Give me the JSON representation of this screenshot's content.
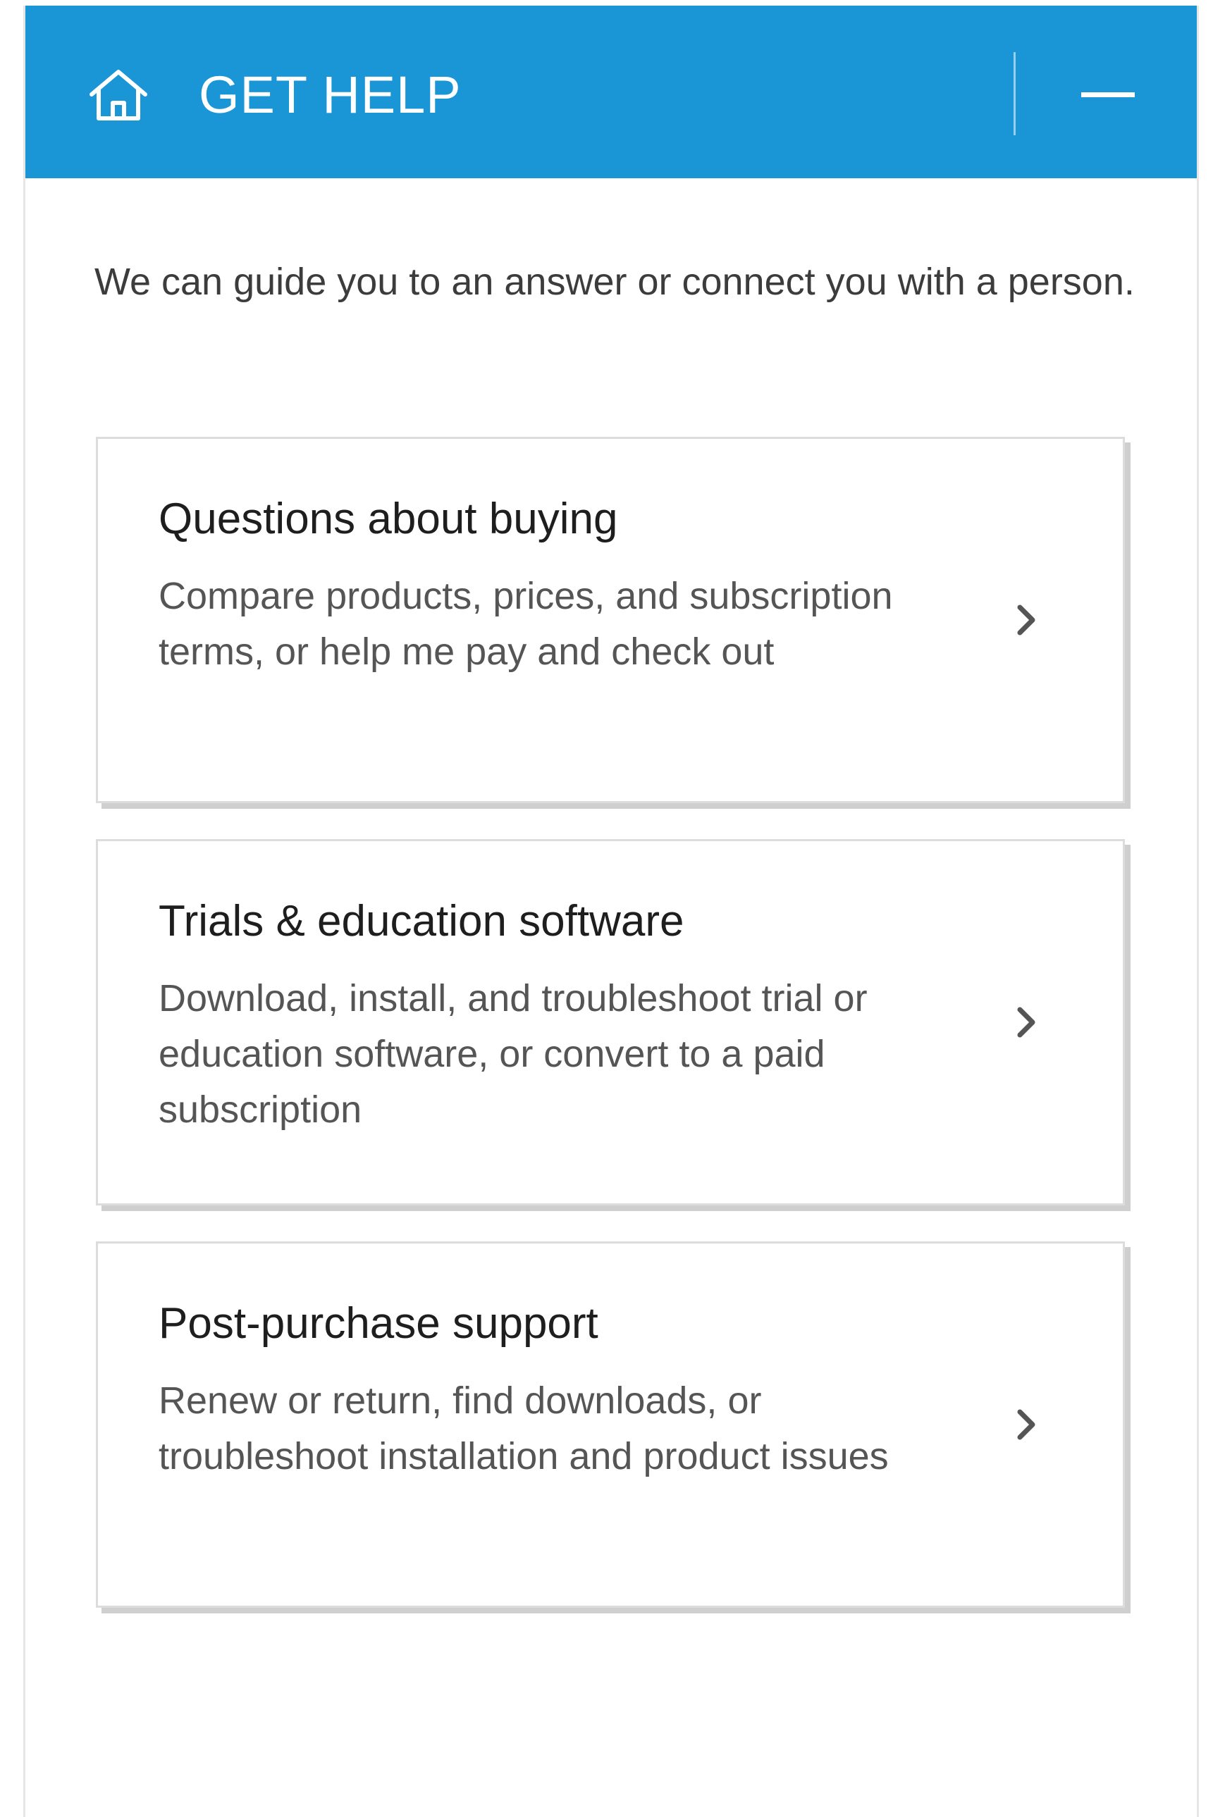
{
  "header": {
    "title": "GET HELP",
    "background_color": "#1a96d6",
    "home_icon": "home-icon",
    "minimize_icon": "minimize-icon"
  },
  "intro": {
    "text": "We can guide you to an answer or connect you with a person."
  },
  "options": [
    {
      "title": "Questions about buying",
      "description": "Compare products, prices, and subscription terms, or help me pay and check out",
      "icon": "chevron-right-icon"
    },
    {
      "title": "Trials & education software",
      "description": "Download, install, and troubleshoot trial or education software, or convert to a paid subscription",
      "icon": "chevron-right-icon"
    },
    {
      "title": "Post-purchase support",
      "description": "Renew or return, find downloads, or troubleshoot installation and product issues",
      "icon": "chevron-right-icon"
    }
  ]
}
